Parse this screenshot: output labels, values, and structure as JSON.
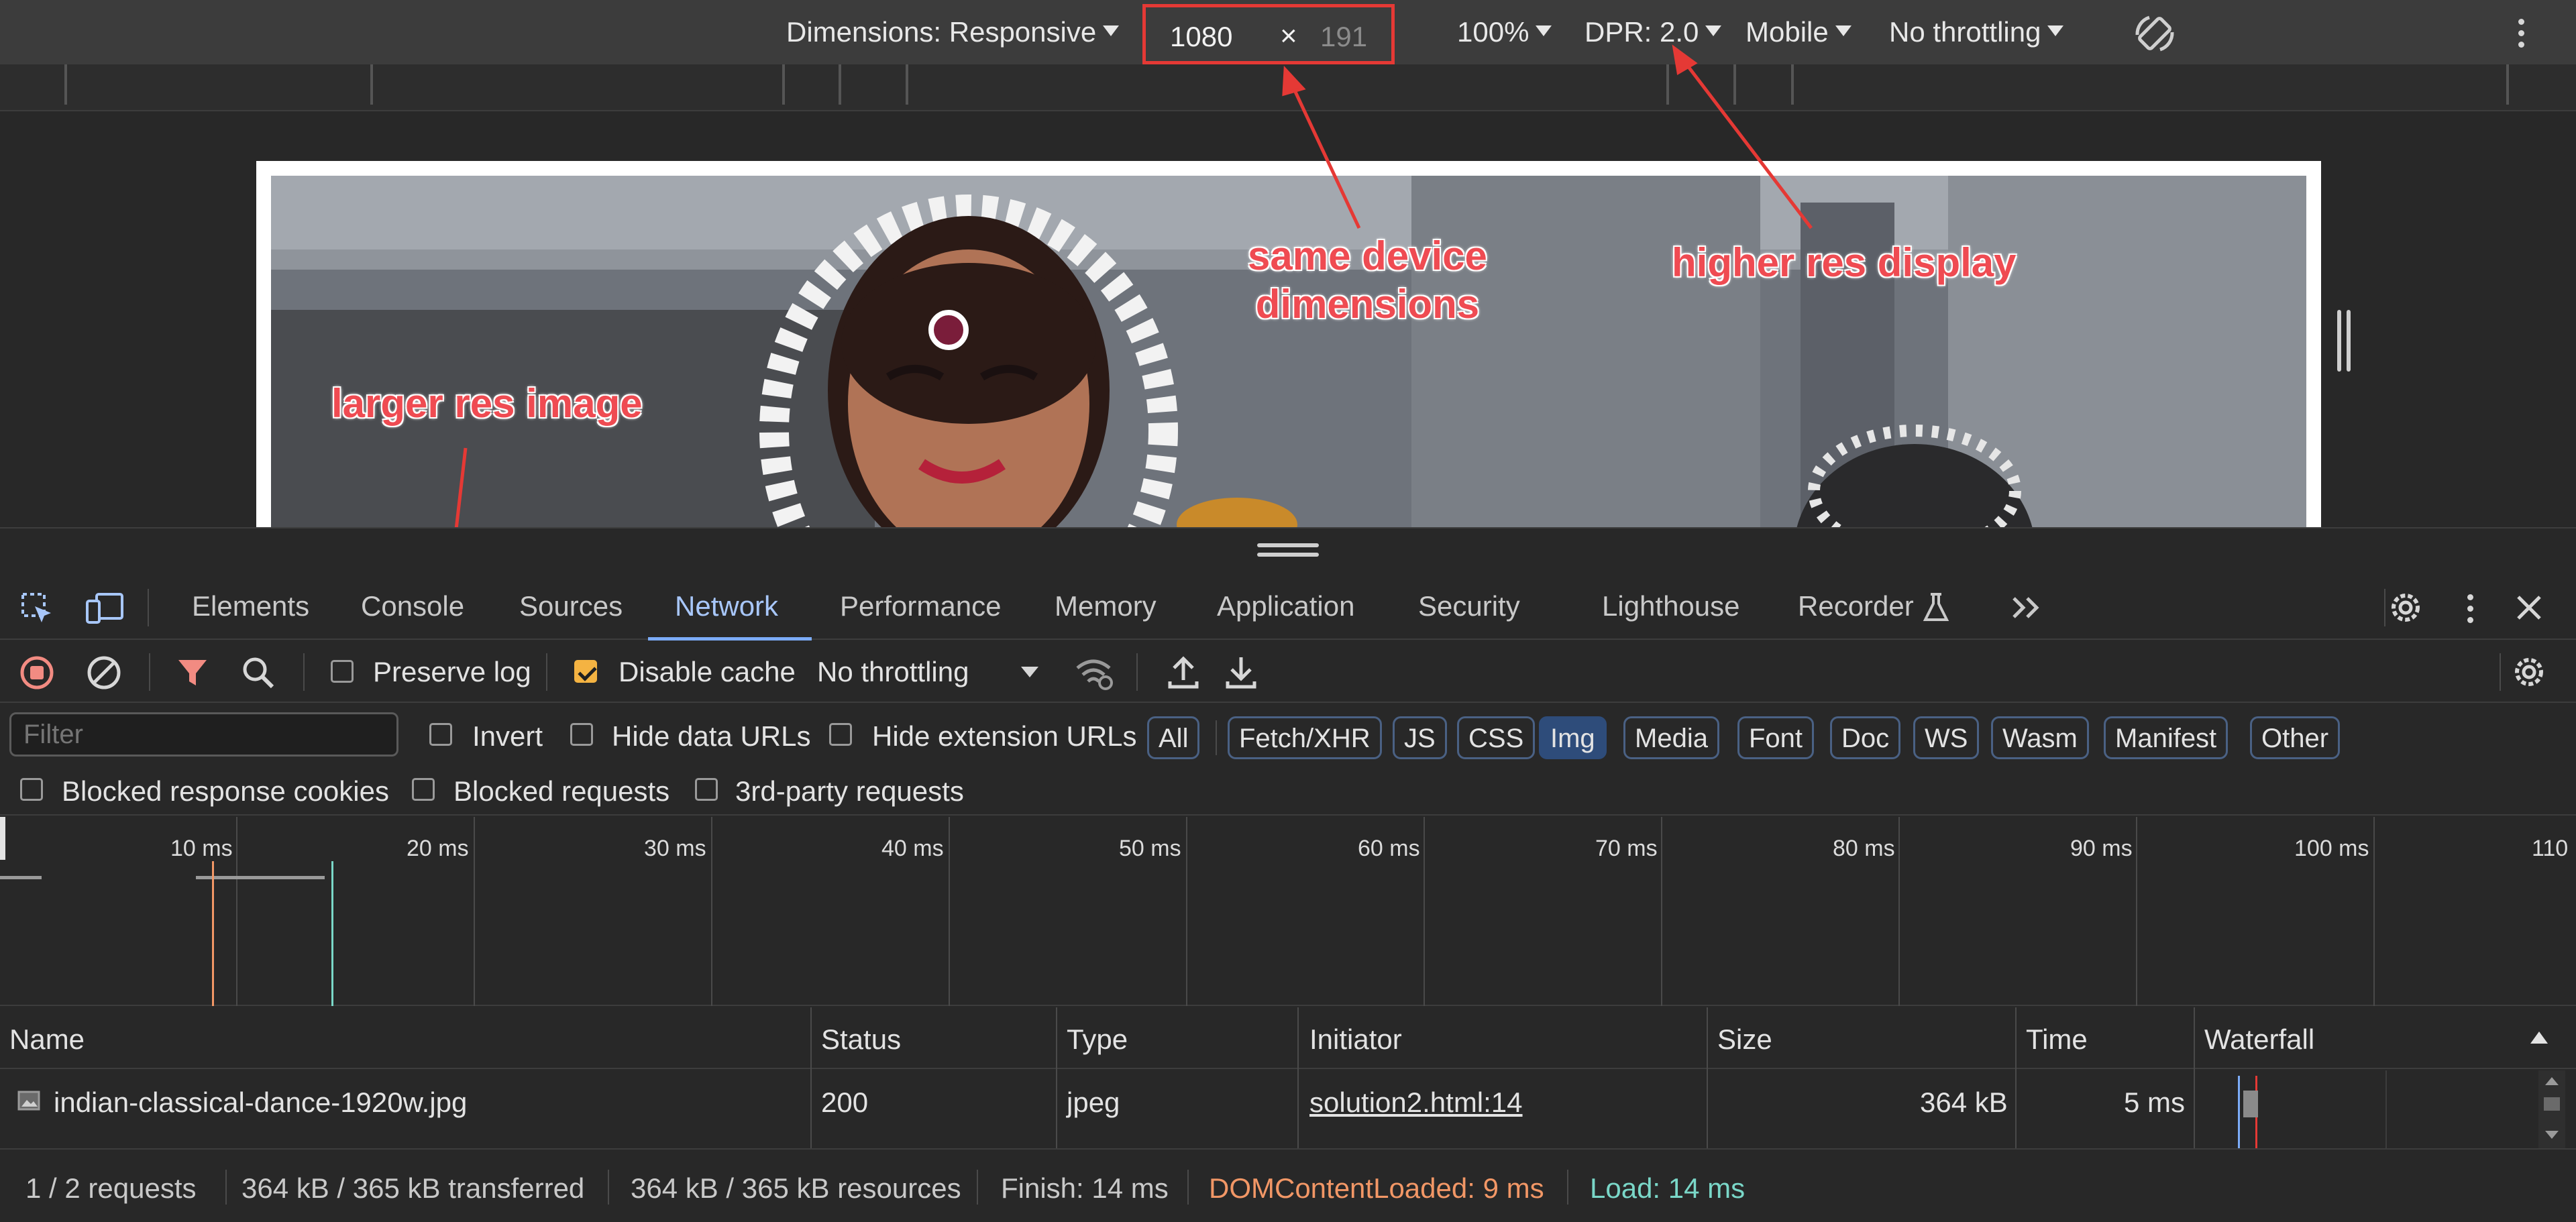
{
  "device_toolbar": {
    "dimensions_label": "Dimensions: Responsive",
    "width_value": "1080",
    "times_symbol": "×",
    "height_placeholder": "191",
    "zoom": "100%",
    "dpr": "DPR: 2.0",
    "device_type": "Mobile",
    "throttling": "No throttling"
  },
  "annotations": {
    "same_device_1": "same device",
    "same_device_2": "dimensions",
    "higher_res": "higher res display",
    "larger_res": "larger res image",
    "color": "#ef4b52"
  },
  "tabs": [
    {
      "label": "Elements"
    },
    {
      "label": "Console"
    },
    {
      "label": "Sources"
    },
    {
      "label": "Network"
    },
    {
      "label": "Performance"
    },
    {
      "label": "Memory"
    },
    {
      "label": "Application"
    },
    {
      "label": "Security"
    },
    {
      "label": "Lighthouse"
    },
    {
      "label": "Recorder"
    }
  ],
  "network_toolbar": {
    "preserve_log": "Preserve log",
    "disable_cache": "Disable cache",
    "throttling": "No throttling"
  },
  "filter": {
    "placeholder": "Filter",
    "invert": "Invert",
    "hide_data_urls": "Hide data URLs",
    "hide_extension_urls": "Hide extension URLs",
    "types": [
      "All",
      "Fetch/XHR",
      "JS",
      "CSS",
      "Img",
      "Media",
      "Font",
      "Doc",
      "WS",
      "Wasm",
      "Manifest",
      "Other"
    ],
    "selected": "Img"
  },
  "filter_row2": {
    "blocked_cookies": "Blocked response cookies",
    "blocked_requests": "Blocked requests",
    "third_party": "3rd-party requests"
  },
  "overview": {
    "ticks": [
      "10 ms",
      "20 ms",
      "30 ms",
      "40 ms",
      "50 ms",
      "60 ms",
      "70 ms",
      "80 ms",
      "90 ms",
      "100 ms",
      "110"
    ]
  },
  "table": {
    "headers": {
      "name": "Name",
      "status": "Status",
      "type": "Type",
      "initiator": "Initiator",
      "size": "Size",
      "time": "Time",
      "waterfall": "Waterfall"
    },
    "rows": [
      {
        "name": "indian-classical-dance-1920w.jpg",
        "status": "200",
        "type": "jpeg",
        "initiator": "solution2.html:14",
        "size": "364 kB",
        "time": "5 ms"
      }
    ]
  },
  "status_bar": {
    "requests": "1 / 2 requests",
    "transferred": "364 kB / 365 kB transferred",
    "resources": "364 kB / 365 kB resources",
    "finish": "Finish: 14 ms",
    "dom_loaded": "DOMContentLoaded: 9 ms",
    "load": "Load: 14 ms"
  },
  "colors": {
    "accent": "#a8c7fa",
    "dom_loaded": "#f29766",
    "load": "#7ad7c8",
    "record": "#f28b82"
  },
  "icons": [
    "inspect-icon",
    "device-icon",
    "settings-icon",
    "kebab-icon",
    "close-icon",
    "record-icon",
    "clear-icon",
    "filter-icon",
    "search-icon",
    "wifi-icon",
    "upload-icon",
    "download-icon",
    "rotate-icon",
    "flask-icon",
    "more-tabs-icon",
    "image-file-icon"
  ]
}
